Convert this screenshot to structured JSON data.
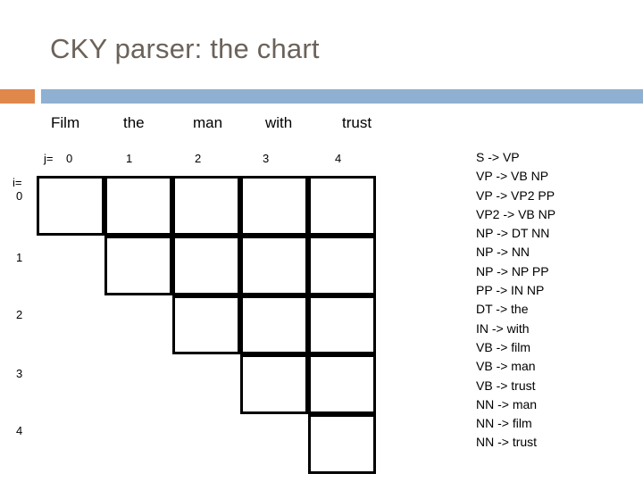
{
  "slide": {
    "title": "CKY parser: the chart",
    "title_color": "#6b6259",
    "accent_square_color": "#e0874b",
    "accent_bar_color": "#8fb0d0"
  },
  "chart": {
    "column_label_prefix": "j=",
    "row_label_prefix": "i=",
    "words": [
      "Film",
      "the",
      "man",
      "with",
      "trust"
    ],
    "column_indices": [
      "0",
      "1",
      "2",
      "3",
      "4"
    ],
    "row_indices": [
      "0",
      "1",
      "2",
      "3",
      "4"
    ],
    "cells": [
      {
        "i": 0,
        "j": 0,
        "text": ""
      },
      {
        "i": 0,
        "j": 1,
        "text": ""
      },
      {
        "i": 0,
        "j": 2,
        "text": ""
      },
      {
        "i": 0,
        "j": 3,
        "text": ""
      },
      {
        "i": 0,
        "j": 4,
        "text": ""
      },
      {
        "i": 1,
        "j": 1,
        "text": ""
      },
      {
        "i": 1,
        "j": 2,
        "text": ""
      },
      {
        "i": 1,
        "j": 3,
        "text": ""
      },
      {
        "i": 1,
        "j": 4,
        "text": ""
      },
      {
        "i": 2,
        "j": 2,
        "text": ""
      },
      {
        "i": 2,
        "j": 3,
        "text": ""
      },
      {
        "i": 2,
        "j": 4,
        "text": ""
      },
      {
        "i": 3,
        "j": 3,
        "text": ""
      },
      {
        "i": 3,
        "j": 4,
        "text": ""
      },
      {
        "i": 4,
        "j": 4,
        "text": ""
      }
    ]
  },
  "grammar": {
    "rules": [
      "S -> VP",
      "VP -> VB NP",
      "VP -> VP2 PP",
      "VP2 -> VB NP",
      "NP -> DT NN",
      "NP -> NN",
      "NP -> NP PP",
      "PP -> IN NP",
      "DT -> the",
      "IN -> with",
      "VB -> film",
      "VB -> man",
      "VB -> trust",
      "NN -> man",
      "NN -> film",
      "NN -> trust"
    ]
  }
}
